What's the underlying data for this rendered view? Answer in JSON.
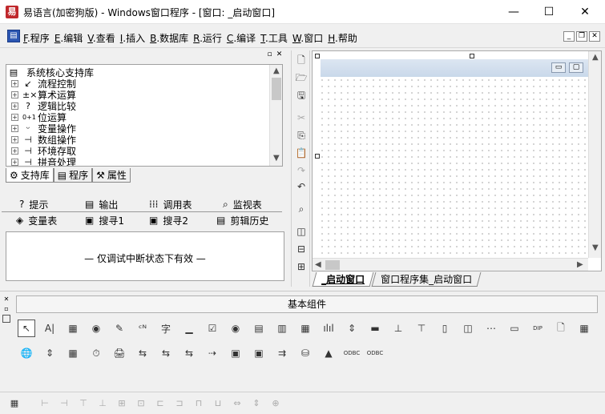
{
  "window": {
    "title": "易语言(加密狗版) - Windows窗口程序 - [窗口: _启动窗口]",
    "app_icon": "易",
    "controls": {
      "minimize": "—",
      "maximize": "☐",
      "close": "✕"
    }
  },
  "menu": {
    "items": [
      {
        "key": "F",
        "label": ".程序"
      },
      {
        "key": "E",
        "label": ".编辑"
      },
      {
        "key": "V",
        "label": ".查看"
      },
      {
        "key": "I",
        "label": ".插入"
      },
      {
        "key": "B",
        "label": ".数据库"
      },
      {
        "key": "R",
        "label": ".运行"
      },
      {
        "key": "C",
        "label": ".编译"
      },
      {
        "key": "T",
        "label": ".工具"
      },
      {
        "key": "W",
        "label": ".窗口"
      },
      {
        "key": "H",
        "label": ".帮助"
      }
    ],
    "mdi_controls": {
      "minimize": "_",
      "restore": "❐",
      "close": "✕"
    }
  },
  "support_panel": {
    "caption_buttons": {
      "maximize": "▫",
      "close": "✕"
    },
    "root_label": "系统核心支持库",
    "tree": [
      {
        "icon": "↙",
        "label": "流程控制"
      },
      {
        "icon": "±×",
        "label": "算术运算"
      },
      {
        "icon": "?",
        "label": "逻辑比较"
      },
      {
        "icon": "0+1",
        "label": "位运算"
      },
      {
        "icon": "ᵕ",
        "label": "变量操作"
      },
      {
        "icon": "⊣",
        "label": "数组操作"
      },
      {
        "icon": "⊣",
        "label": "环境存取"
      },
      {
        "icon": "⊣",
        "label": "拼音处理"
      }
    ],
    "tabs": [
      {
        "icon": "⚙",
        "label": "支持库"
      },
      {
        "icon": "▤",
        "label": "程序"
      },
      {
        "icon": "⚒",
        "label": "属性"
      }
    ]
  },
  "output_panel": {
    "tabs_row1": [
      {
        "icon": "?",
        "label": "提示"
      },
      {
        "icon": "▤",
        "label": "输出"
      },
      {
        "icon": "⁞⁞⁞",
        "label": "调用表"
      },
      {
        "icon": "⌕",
        "label": "监视表"
      }
    ],
    "tabs_row2": [
      {
        "icon": "◈",
        "label": "变量表"
      },
      {
        "icon": "▣",
        "label": "搜寻1"
      },
      {
        "icon": "▣",
        "label": "搜寻2"
      },
      {
        "icon": "▤",
        "label": "剪辑历史"
      }
    ],
    "message": "— 仅调试中断状态下有效 —"
  },
  "vertical_toolbar": [
    {
      "icon": "🗋",
      "name": "new-icon"
    },
    {
      "icon": "🗁",
      "name": "open-icon"
    },
    {
      "icon": "🖫",
      "name": "save-icon"
    },
    {
      "icon": "✂",
      "name": "cut-icon"
    },
    {
      "icon": "⎘",
      "name": "copy-icon"
    },
    {
      "icon": "📋",
      "name": "paste-icon"
    },
    {
      "icon": "↷",
      "name": "redo-icon"
    },
    {
      "icon": "↶",
      "name": "undo-icon"
    },
    {
      "icon": "⌕",
      "name": "find-icon"
    },
    {
      "icon": "◫",
      "name": "layout-left-icon"
    },
    {
      "icon": "⊟",
      "name": "layout-bottom-icon"
    },
    {
      "icon": "⊞",
      "name": "layout-grid-icon"
    }
  ],
  "design": {
    "form_buttons": {
      "minimize": "▭",
      "maximize": "▢"
    },
    "tabs": [
      "_启动窗口",
      "窗口程序集_启动窗口"
    ]
  },
  "components": {
    "header": "基本组件",
    "row1": [
      "↖",
      "A|",
      "▦",
      "◉",
      "✎",
      "ᶜᴺ",
      "字",
      "▁",
      "☑",
      "◉",
      "▤",
      "▥",
      "▦",
      "ılıl",
      "⇕",
      "▬",
      "⊥",
      "⊤",
      "▯",
      "◫",
      "⋯",
      "▭",
      "DIP",
      "🗋",
      "▦"
    ],
    "row2": [
      "🌐",
      "⇕",
      "▦",
      "⏱",
      "🖨",
      "⇆",
      "⇆",
      "⇆",
      "⇢",
      "▣",
      "▣",
      "⇉",
      "⛁",
      "▲",
      "ODBC",
      "ODBC"
    ],
    "row1_names": [
      "pointer-icon",
      "label-icon",
      "picture-icon",
      "shape-icon",
      "edit-icon",
      "button-icon",
      "text-icon",
      "line-icon",
      "checkbox-icon",
      "radio-icon",
      "listbox-icon",
      "combo-icon",
      "grid-icon",
      "progress-icon",
      "scroll-icon",
      "hslider-icon",
      "hbar-icon",
      "vbar-icon",
      "tab-icon",
      "frame-icon",
      "dots-icon",
      "panel-icon",
      "dip-icon",
      "file-icon",
      "table-icon"
    ],
    "row2_names": [
      "network-icon",
      "spinner-icon",
      "calendar-icon",
      "timer-icon",
      "printer-icon",
      "data-icon-1",
      "data-icon-2",
      "data-icon-3",
      "link-icon",
      "form-icon-1",
      "form-icon-2",
      "list-icon",
      "database-icon",
      "chart-icon",
      "odbc-icon-1",
      "odbc-icon-2"
    ]
  },
  "bottom_toolbar": [
    "▦",
    "⊢",
    "⊣",
    "⊤",
    "⊥",
    "⊞",
    "⊡",
    "⊏",
    "⊐",
    "⊓",
    "⊔",
    "⇔",
    "⇕",
    "⊕"
  ]
}
